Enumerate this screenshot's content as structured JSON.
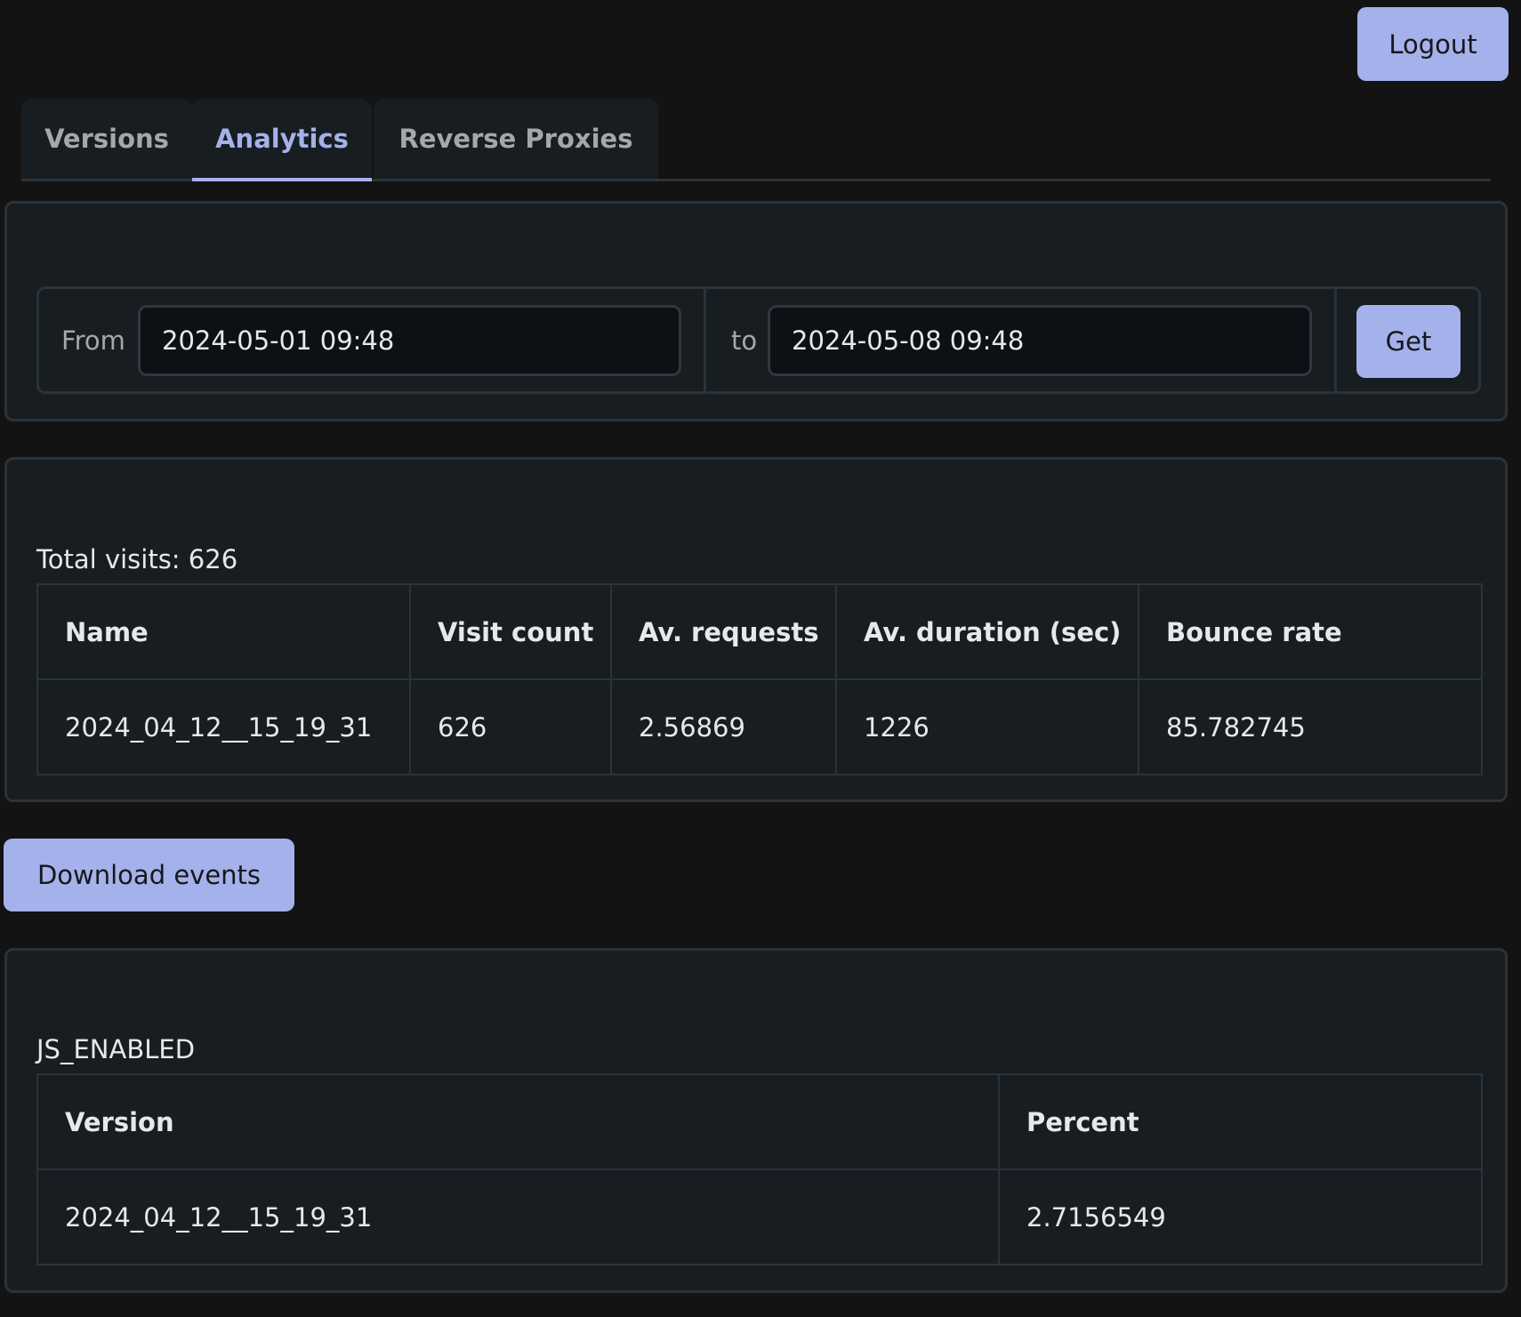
{
  "header": {
    "logout_label": "Logout"
  },
  "tabs": [
    {
      "label": "Versions",
      "active": false
    },
    {
      "label": "Analytics",
      "active": true
    },
    {
      "label": "Reverse Proxies",
      "active": false
    }
  ],
  "date_range": {
    "from_label": "From",
    "from_value": "2024-05-01 09:48",
    "to_label": "to",
    "to_value": "2024-05-08 09:48",
    "get_label": "Get"
  },
  "summary": {
    "total_visits_text": "Total visits: 626",
    "columns": [
      "Name",
      "Visit count",
      "Av. requests",
      "Av. duration (sec)",
      "Bounce rate"
    ],
    "rows": [
      [
        "2024_04_12__15_19_31",
        "626",
        "2.56869",
        "1226",
        "85.782745"
      ]
    ]
  },
  "download": {
    "label": "Download events"
  },
  "js_enabled": {
    "title": "JS_ENABLED",
    "columns": [
      "Version",
      "Percent"
    ],
    "rows": [
      [
        "2024_04_12__15_19_31",
        "2.7156549"
      ]
    ]
  },
  "colors": {
    "background": "#131313",
    "panel": "#171d21",
    "border": "#2c3338",
    "accent": "#a5b1ea",
    "text": "#e6e8ea",
    "muted_text": "#a3a8ad"
  }
}
